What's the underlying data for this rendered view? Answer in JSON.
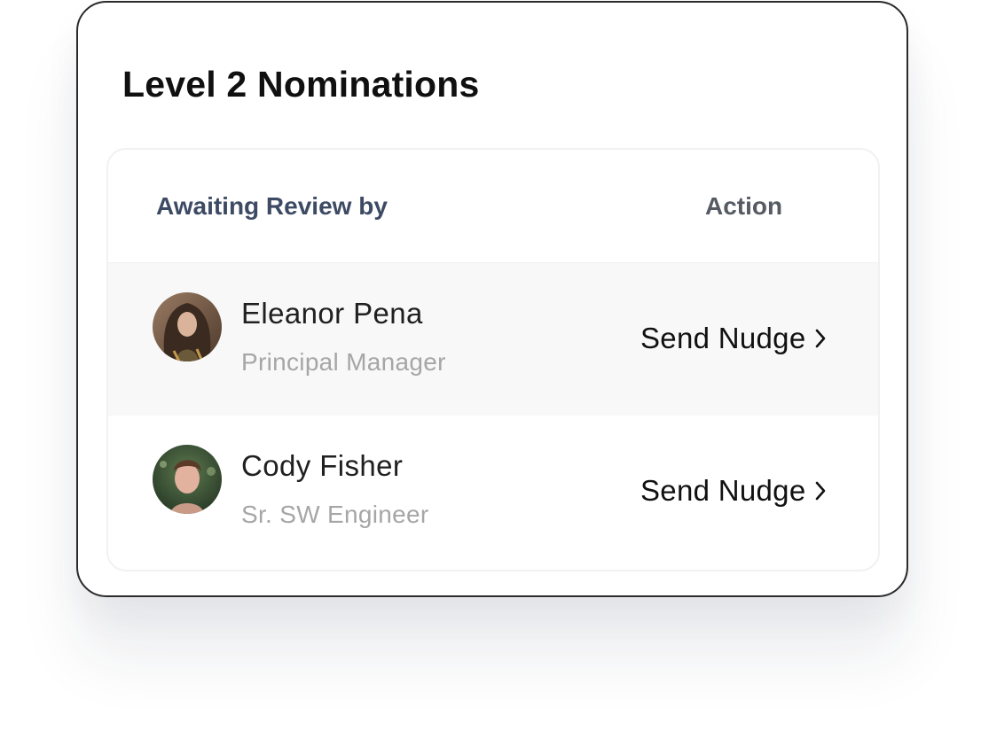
{
  "card": {
    "title": "Level 2 Nominations"
  },
  "table": {
    "headers": {
      "name": "Awaiting Review by",
      "action": "Action"
    },
    "rows": [
      {
        "name": "Eleanor Pena",
        "role": "Principal Manager",
        "action_label": "Send Nudge",
        "avatar": "woman-photo-avatar"
      },
      {
        "name": "Cody Fisher",
        "role": "Sr. SW Engineer",
        "action_label": "Send Nudge",
        "avatar": "man-photo-avatar"
      }
    ]
  },
  "icons": {
    "action_chevron": "chevron-right-icon"
  },
  "colors": {
    "header_text": "#3d4a63",
    "role_text": "#a6a6a6",
    "row_highlight": "#f8f8f8",
    "card_border": "#2b2b2b"
  }
}
